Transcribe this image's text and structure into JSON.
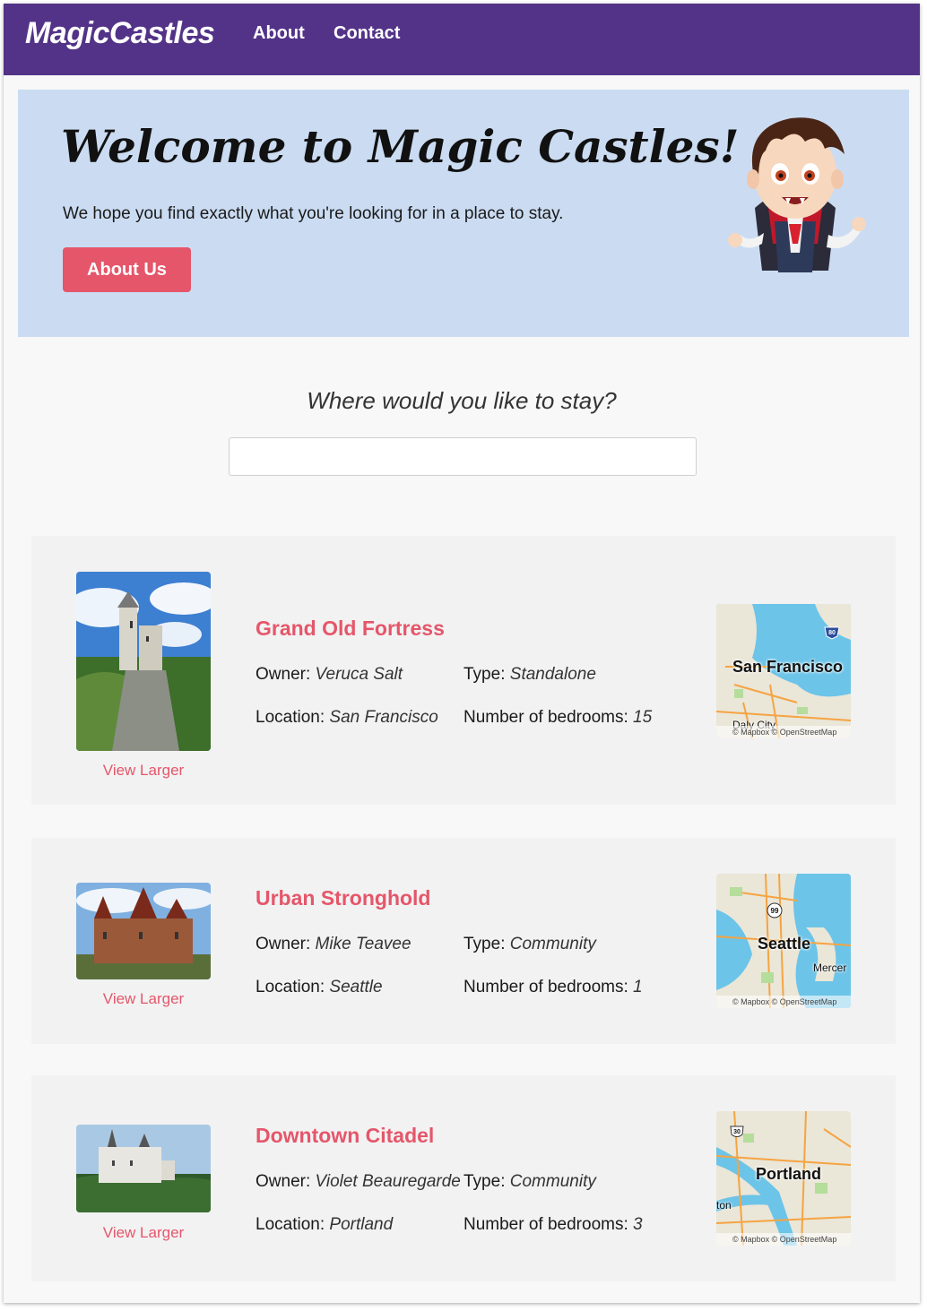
{
  "nav": {
    "brand": "MagicCastles",
    "links": [
      "About",
      "Contact"
    ]
  },
  "hero": {
    "title": "Welcome to Magic Castles!",
    "subtitle": "We hope you find exactly what you're looking for in a place to stay.",
    "button": "About Us"
  },
  "search": {
    "question": "Where would you like to stay?",
    "value": ""
  },
  "labels": {
    "owner": "Owner:",
    "type": "Type:",
    "location": "Location:",
    "bedrooms": "Number of bedrooms:",
    "view_larger": "View Larger",
    "map_attribution": "© Mapbox © OpenStreetMap"
  },
  "listings": [
    {
      "name": "Grand Old Fortress",
      "owner": "Veruca Salt",
      "type": "Standalone",
      "location": "San Francisco",
      "bedrooms": "15",
      "map_label": "San Francisco",
      "map_extra": "Daly City",
      "map_shield": "80"
    },
    {
      "name": "Urban Stronghold",
      "owner": "Mike Teavee",
      "type": "Community",
      "location": "Seattle",
      "bedrooms": "1",
      "map_label": "Seattle",
      "map_extra": "Mercer",
      "map_shield": "99"
    },
    {
      "name": "Downtown Citadel",
      "owner": "Violet Beauregarde",
      "type": "Community",
      "location": "Portland",
      "bedrooms": "3",
      "map_label": "Portland",
      "map_extra": "ton",
      "map_shield": "30"
    }
  ],
  "colors": {
    "navbar": "#533388",
    "accent": "#e5566a",
    "hero_bg": "#cbdcf2"
  }
}
